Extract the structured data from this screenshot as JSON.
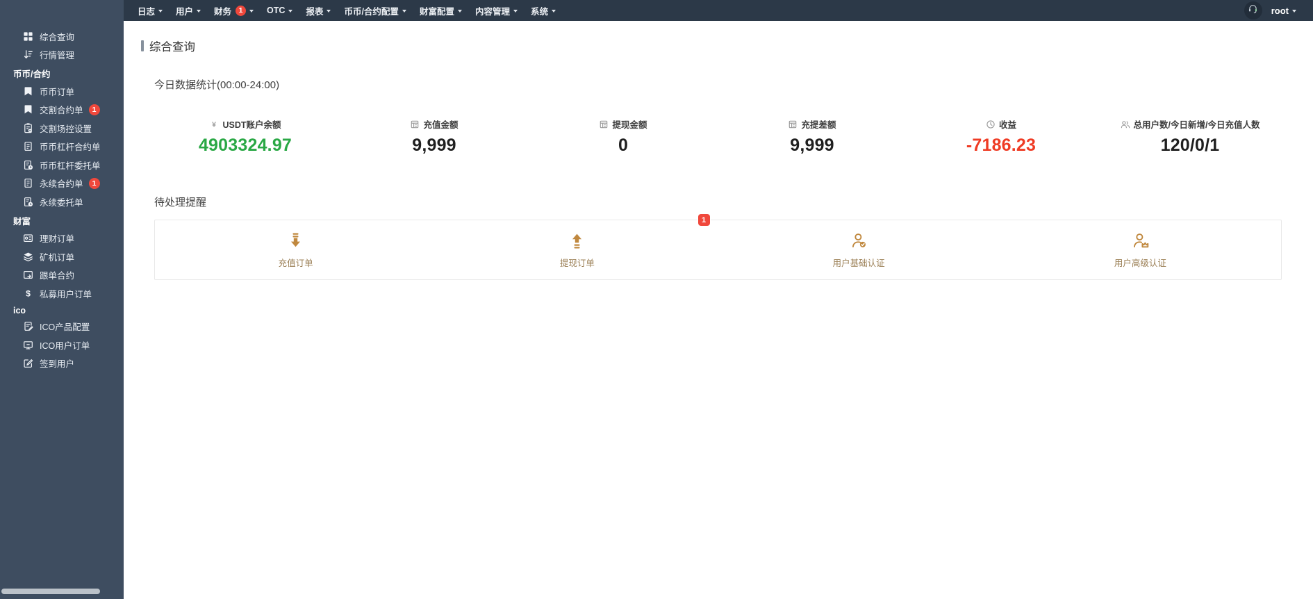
{
  "colors": {
    "sidebar_bg": "#3e4d60",
    "topnav_bg": "#2c3948",
    "badge_red": "#f0483c",
    "accent_green": "#2aa845",
    "accent_red": "#ef3b24",
    "pending_icon": "#c0883e"
  },
  "topnav": {
    "items": [
      {
        "label": "日志"
      },
      {
        "label": "用户"
      },
      {
        "label": "财务",
        "badge": "1"
      },
      {
        "label": "OTC"
      },
      {
        "label": "报表"
      },
      {
        "label": "币币/合约配置"
      },
      {
        "label": "财富配置"
      },
      {
        "label": "内容管理"
      },
      {
        "label": "系统"
      }
    ],
    "user": {
      "name": "root",
      "avatar_icon": "headset-icon"
    }
  },
  "sidebar": {
    "entries": [
      {
        "type": "item",
        "icon": "grid-icon",
        "label": "综合查询"
      },
      {
        "type": "item",
        "icon": "market-icon",
        "label": "行情管理"
      },
      {
        "type": "section",
        "label": "币币/合约"
      },
      {
        "type": "item",
        "icon": "bookmark-icon",
        "label": "币币订单"
      },
      {
        "type": "item",
        "icon": "bookmark-icon",
        "label": "交割合约单",
        "badge": "1"
      },
      {
        "type": "item",
        "icon": "clipboard-gear-icon",
        "label": "交割场控设置"
      },
      {
        "type": "item",
        "icon": "doc-icon",
        "label": "币币杠杆合约单"
      },
      {
        "type": "item",
        "icon": "doc-clock-icon",
        "label": "币币杠杆委托单"
      },
      {
        "type": "item",
        "icon": "doc-icon",
        "label": "永续合约单",
        "badge": "1"
      },
      {
        "type": "item",
        "icon": "doc-clock-icon",
        "label": "永续委托单"
      },
      {
        "type": "section",
        "label": "财富"
      },
      {
        "type": "item",
        "icon": "wallet-icon",
        "label": "理财订单"
      },
      {
        "type": "item",
        "icon": "layers-icon",
        "label": "矿机订单"
      },
      {
        "type": "item",
        "icon": "card-arrow-icon",
        "label": "跟单合约"
      },
      {
        "type": "item",
        "icon": "dollar-icon",
        "label": "私募用户订单"
      },
      {
        "type": "section",
        "label": "ico"
      },
      {
        "type": "item",
        "icon": "doc-edit-icon",
        "label": "ICO产品配置"
      },
      {
        "type": "item",
        "icon": "monitor-icon",
        "label": "ICO用户订单"
      },
      {
        "type": "item",
        "icon": "edit-square-icon",
        "label": "签到用户"
      }
    ]
  },
  "main": {
    "page_title": "综合查询",
    "stats_title": "今日数据统计(00:00-24:00)",
    "stats": [
      {
        "icon": "yen-icon",
        "label": "USDT账户余额",
        "value": "4903324.97",
        "color": "green"
      },
      {
        "icon": "billing-icon",
        "label": "充值金额",
        "value": "9,999",
        "color": "dark"
      },
      {
        "icon": "billing-icon",
        "label": "提现金额",
        "value": "0",
        "color": "dark"
      },
      {
        "icon": "billing-icon",
        "label": "充提差额",
        "value": "9,999",
        "color": "dark"
      },
      {
        "icon": "clock-icon",
        "label": "收益",
        "value": "-7186.23",
        "color": "red"
      },
      {
        "icon": "users-icon",
        "label": "总用户数/今日新增/今日充值人数",
        "value": "120/0/1",
        "color": "dark"
      }
    ],
    "pending_title": "待处理提醒",
    "pending_items": [
      {
        "icon": "deposit-icon",
        "label": "充值订单"
      },
      {
        "icon": "withdraw-icon",
        "label": "提现订单",
        "badge": "1"
      },
      {
        "icon": "user-check-icon",
        "label": "用户基础认证"
      },
      {
        "icon": "user-crown-icon",
        "label": "用户高级认证"
      }
    ]
  }
}
